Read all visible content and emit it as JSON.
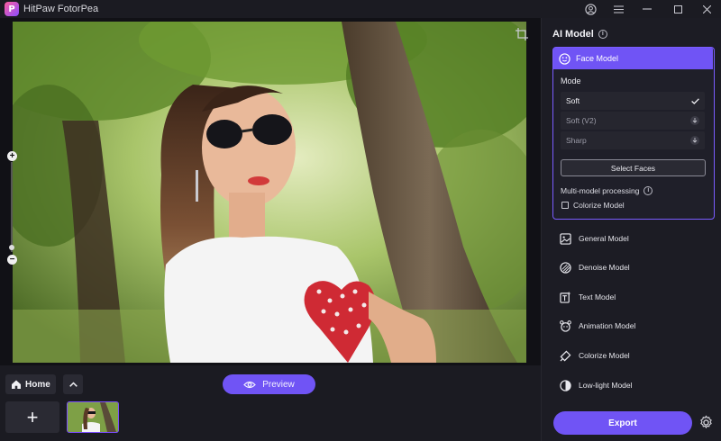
{
  "app": {
    "logo_letter": "P",
    "title": "HitPaw FotorPea"
  },
  "canvas": {
    "zoom_plus": "+",
    "zoom_minus": "−"
  },
  "bottom": {
    "home_label": "Home",
    "add_label": "+",
    "preview_label": "Preview"
  },
  "panel": {
    "title": "AI Model",
    "face_model": {
      "label": "Face Model",
      "mode_label": "Mode",
      "modes": [
        {
          "label": "Soft",
          "state": "selected"
        },
        {
          "label": "Soft (V2)",
          "state": "download"
        },
        {
          "label": "Sharp",
          "state": "download"
        }
      ],
      "select_faces_label": "Select Faces",
      "multi_model_label": "Multi-model processing",
      "colorize_label": "Colorize Model",
      "colorize_checked": false
    },
    "models": [
      {
        "label": "General Model",
        "icon": "image-icon"
      },
      {
        "label": "Denoise Model",
        "icon": "denoise-icon"
      },
      {
        "label": "Text Model",
        "icon": "text-icon"
      },
      {
        "label": "Animation Model",
        "icon": "animation-icon"
      },
      {
        "label": "Colorize Model",
        "icon": "colorize-icon"
      },
      {
        "label": "Low-light Model",
        "icon": "low-light-icon"
      }
    ],
    "export_label": "Export"
  },
  "colors": {
    "accent": "#7054f5",
    "panel_bg": "#1c1c24",
    "app_bg": "#17171d"
  }
}
